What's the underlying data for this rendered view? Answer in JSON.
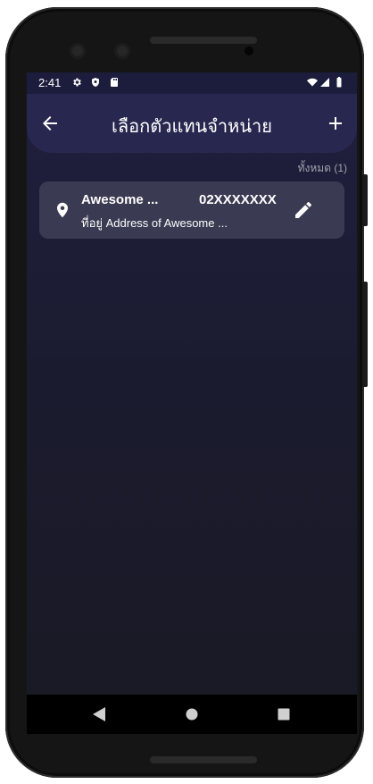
{
  "status_bar": {
    "time": "2:41",
    "icons": [
      "settings-icon",
      "shield-icon",
      "sd-card-icon",
      "wifi-icon",
      "signal-icon",
      "battery-icon"
    ]
  },
  "app_bar": {
    "title": "เลือกตัวแทนจำหน่าย",
    "back_icon": "arrow-back-icon",
    "add_icon": "plus-icon"
  },
  "list": {
    "count_label": "ทั้งหมด (1)",
    "items": [
      {
        "name": "Awesome ...",
        "phone": "02XXXXXXX",
        "address": "ที่อยู่ Address of Awesome ...",
        "icon": "location-pin-icon",
        "action_icon": "pencil-icon"
      }
    ]
  },
  "nav_bar": {
    "icons": [
      "back-triangle-icon",
      "home-circle-icon",
      "recents-square-icon"
    ]
  },
  "colors": {
    "background": "#1b1b30",
    "app_bar": "#272750",
    "card": "#3a3a52",
    "text": "#ffffff",
    "muted_text": "#a2a2b0"
  }
}
